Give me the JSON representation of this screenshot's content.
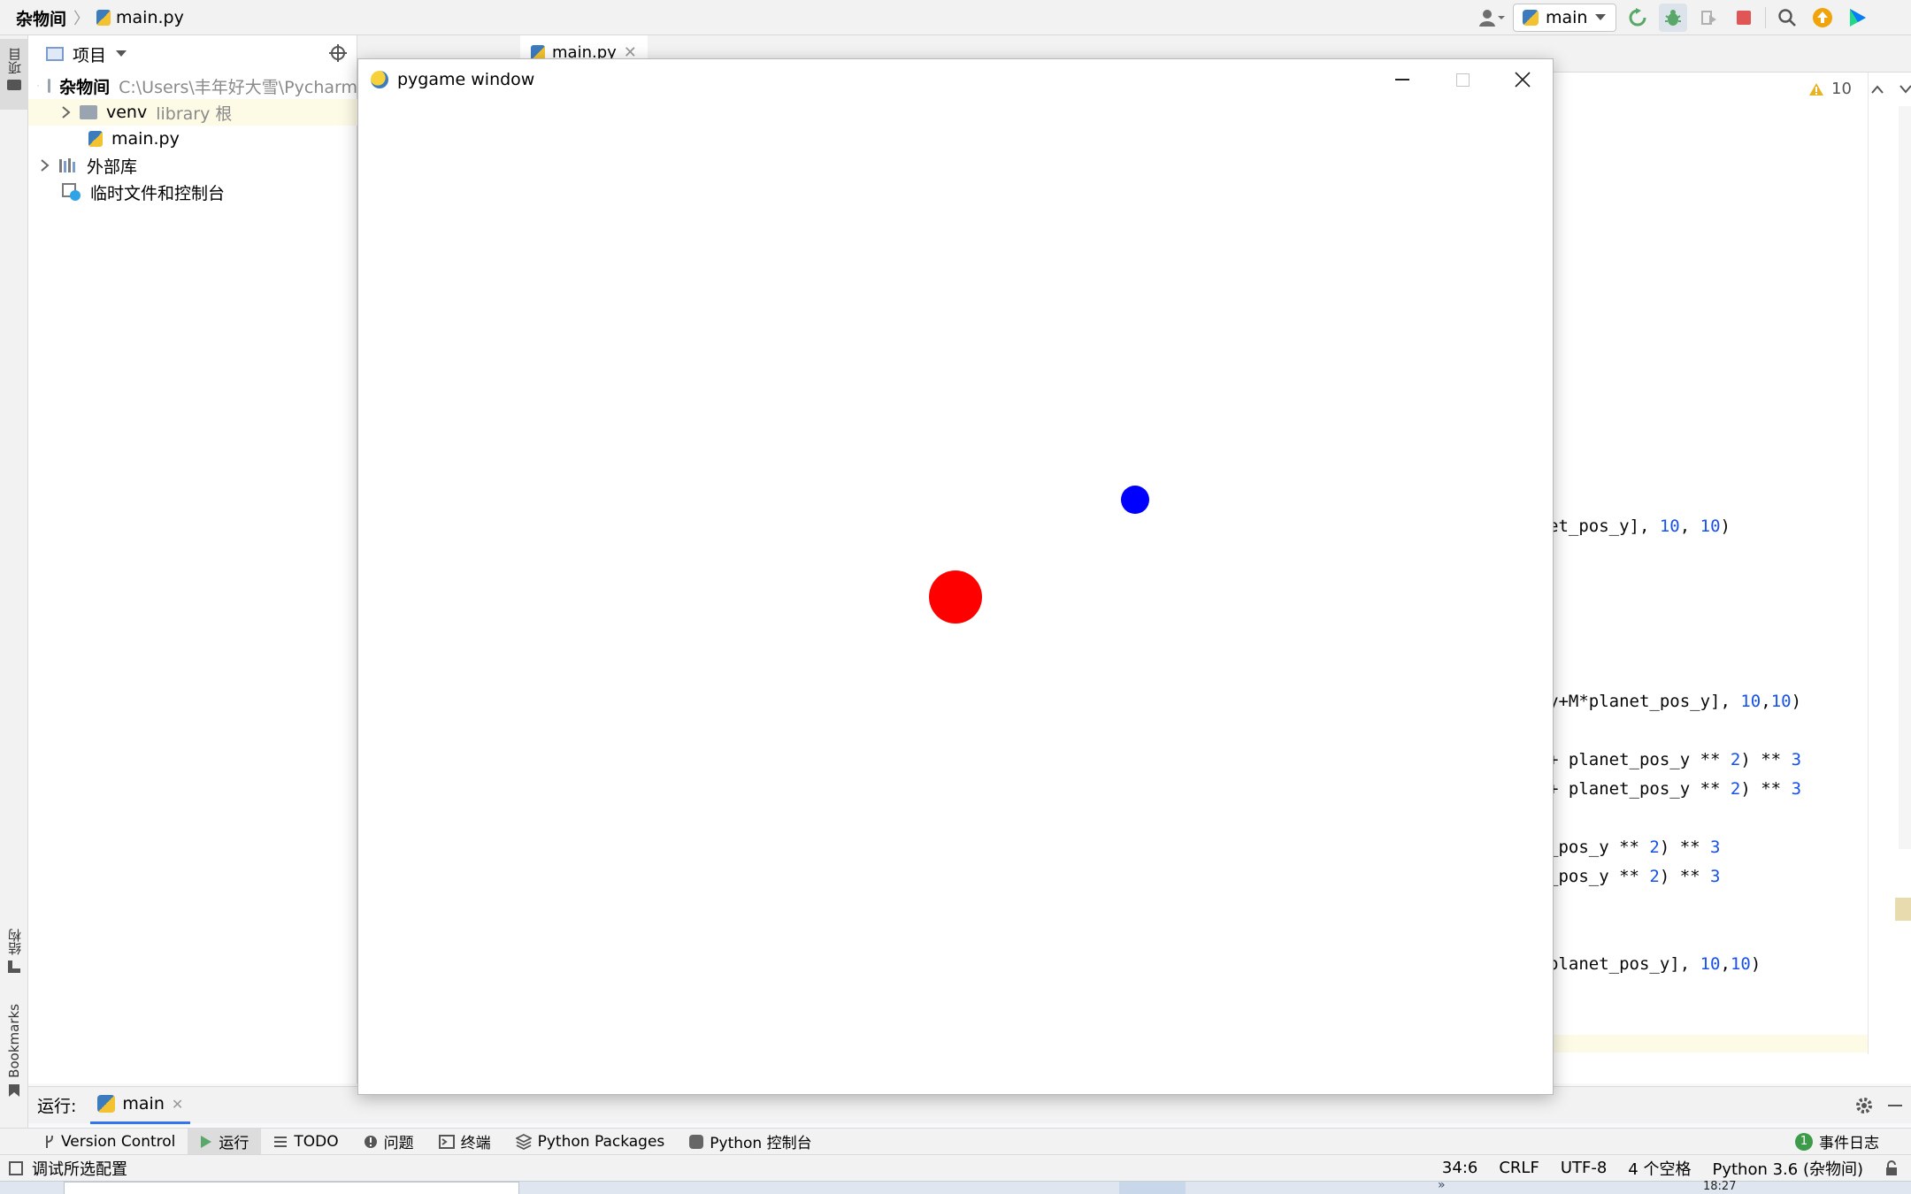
{
  "navbar": {
    "project_name": "杂物间",
    "file_name": "main.py",
    "run_config": "main"
  },
  "left_stripe": {
    "project_label": "项目",
    "structure_label": "结构",
    "bookmarks_label": "Bookmarks"
  },
  "project_panel": {
    "title": "项目",
    "tree": [
      {
        "name": "杂物间",
        "extra": "C:\\Users\\丰年好大雪\\Pycharm"
      },
      {
        "name": "venv",
        "extra": "library 根"
      },
      {
        "name": "main.py",
        "extra": ""
      },
      {
        "name": "外部库",
        "extra": ""
      },
      {
        "name": "临时文件和控制台",
        "extra": ""
      }
    ]
  },
  "editor": {
    "tab_label": "main.py",
    "warnings_count": "10",
    "code_lines": [
      {
        "text": "et_pos_y], ",
        "n1": "10",
        "sep": ", ",
        "n2": "10",
        "tail": ")"
      },
      {
        "text": "y+M*planet_pos_y], ",
        "n1": "10",
        "sep": ",",
        "n2": "10",
        "tail": ")"
      },
      {
        "text": "+ planet_pos_y ** ",
        "n1": "2",
        "sep": ") ** ",
        "n2": "3",
        "tail": ""
      },
      {
        "text": "+ planet_pos_y ** ",
        "n1": "2",
        "sep": ") ** ",
        "n2": "3",
        "tail": ""
      },
      {
        "text": "_pos_y ** ",
        "n1": "2",
        "sep": ") ** ",
        "n2": "3",
        "tail": ""
      },
      {
        "text": "_pos_y ** ",
        "n1": "2",
        "sep": ") ** ",
        "n2": "3",
        "tail": ""
      },
      {
        "text": "planet_pos_y], ",
        "n1": "10",
        "sep": ",",
        "n2": "10",
        "tail": ")"
      }
    ]
  },
  "pygame_window": {
    "title": "pygame window",
    "objects": [
      {
        "name": "sun",
        "color": "#ff0000"
      },
      {
        "name": "planet",
        "color": "#0000ff"
      }
    ]
  },
  "run_bar": {
    "label": "运行:",
    "tab": "main"
  },
  "tool_tabs": [
    "Version Control",
    "运行",
    "TODO",
    "问题",
    "终端",
    "Python Packages",
    "Python 控制台"
  ],
  "event_log": {
    "count": "1",
    "label": "事件日志"
  },
  "status_bar": {
    "message": "调试所选配置",
    "position": "34:6",
    "line_sep": "CRLF",
    "encoding": "UTF-8",
    "indent": "4 个空格",
    "interpreter": "Python 3.6 (杂物间)"
  },
  "taskbar": {
    "time": "18:27"
  },
  "colors": {
    "accent_blue": "#3574f0",
    "run_green": "#59a869",
    "stop_red": "#e05555"
  }
}
